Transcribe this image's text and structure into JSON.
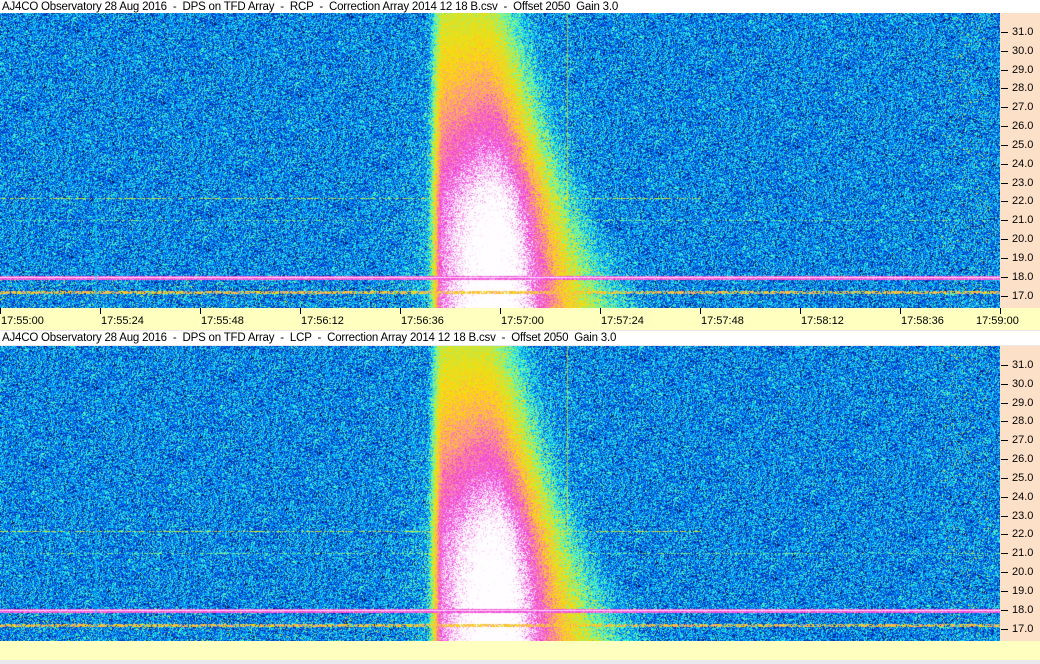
{
  "panels": [
    {
      "title": "AJ4CO Observatory 28 Aug 2016  -  DPS on TFD Array  -  RCP  -  Correction Array 2014 12 18 B.csv  -  Offset 2050  Gain 3.0",
      "polarization": "RCP"
    },
    {
      "title": "AJ4CO Observatory 28 Aug 2016  -  DPS on TFD Array  -  LCP  -  Correction Array 2014 12 18 B.csv  -  Offset 2050  Gain 3.0",
      "polarization": "LCP"
    }
  ],
  "chart_data": {
    "type": "heatmap",
    "x_ticks": [
      "17:55:00",
      "17:55:24",
      "17:55:48",
      "17:56:12",
      "17:56:36",
      "17:57:00",
      "17:57:24",
      "17:57:48",
      "17:58:12",
      "17:58:36",
      "17:59:00"
    ],
    "xlim": [
      "17:55:00",
      "17:59:00"
    ],
    "y_ticks": [
      "31.0",
      "30.0",
      "29.0",
      "28.0",
      "27.0",
      "26.0",
      "25.0",
      "24.0",
      "23.0",
      "22.0",
      "21.0",
      "20.0",
      "19.0",
      "18.0",
      "17.0"
    ],
    "ylim": [
      16.35,
      32.0
    ],
    "colormap": [
      "#000014",
      "#001e8c",
      "#0050e6",
      "#00b4ff",
      "#50ffc8",
      "#c8e63c",
      "#ffdc00",
      "#ff9a8c",
      "#f03cdc",
      "#ffffff"
    ],
    "event": {
      "type": "burst",
      "onset": "17:56:42",
      "peak": "17:56:58",
      "drift": "high to low frequency",
      "end_high_freq": "17:57:20",
      "end_low_freq": "17:57:40"
    },
    "interference_lines_mhz": [
      18.0,
      17.2,
      22.2,
      21.0
    ]
  },
  "colors": {
    "freq_axis_bg": "#fde0c8",
    "time_axis_bg": "#ffffc0"
  }
}
